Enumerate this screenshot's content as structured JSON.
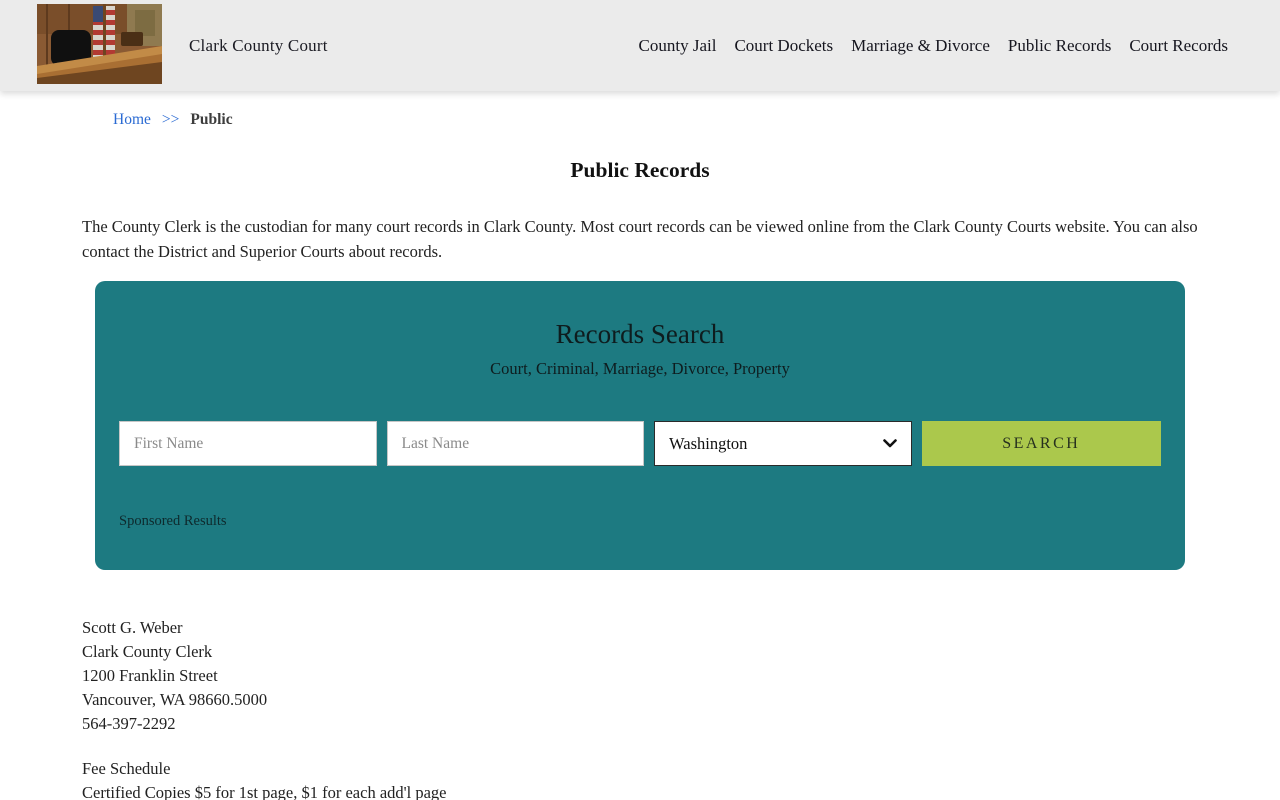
{
  "header": {
    "site_title": "Clark County Court",
    "nav": [
      {
        "label": "County Jail"
      },
      {
        "label": "Court Dockets"
      },
      {
        "label": "Marriage & Divorce"
      },
      {
        "label": "Public Records"
      },
      {
        "label": "Court Records"
      }
    ]
  },
  "breadcrumb": {
    "home": "Home",
    "separator": ">>",
    "current": "Public"
  },
  "page": {
    "title": "Public Records",
    "intro": "The County Clerk is the custodian for many court records in Clark County. Most court records can be viewed online from the Clark County Courts website. You can also contact the District and Superior Courts about records."
  },
  "search_panel": {
    "title": "Records Search",
    "subtitle": "Court, Criminal, Marriage, Divorce, Property",
    "first_name_placeholder": "First Name",
    "last_name_placeholder": "Last Name",
    "state_selected": "Washington",
    "search_label": "SEARCH",
    "sponsored_label": "Sponsored Results"
  },
  "contact": {
    "line1": "Scott G. Weber",
    "line2": "Clark County Clerk",
    "line3": "1200 Franklin Street",
    "line4": "Vancouver, WA 98660.5000",
    "line5": "564-397-2292"
  },
  "fees": {
    "line1": "Fee Schedule",
    "line2": "Certified Copies $5 for 1st page, $1 for each add'l page"
  },
  "colors": {
    "header_bg": "#ebebeb",
    "panel_bg": "#1d7a81",
    "button_bg": "#abc84c",
    "link_blue": "#2b6bd3"
  }
}
